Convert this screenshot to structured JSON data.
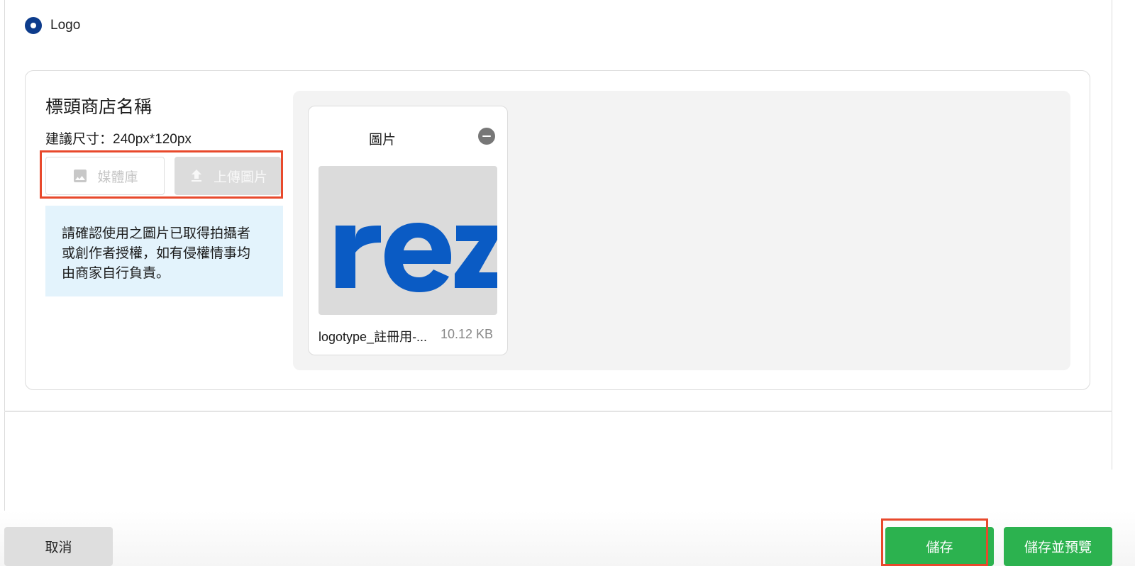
{
  "logo_option": {
    "label": "Logo",
    "selected": true
  },
  "section": {
    "title": "標頭商店名稱",
    "size_hint": "建議尺寸：240px*120px"
  },
  "buttons": {
    "media_library": "媒體庫",
    "upload_image": "上傳圖片"
  },
  "notice": {
    "line1": "請確認使用之圖片已取得拍攝者",
    "line2": "或創作者授權，如有侵權情事均",
    "line3": "由商家自行負責。"
  },
  "image_card": {
    "title": "圖片",
    "file_name": "logotype_註冊用-...",
    "file_size": "10.12 KB",
    "logo_text": "rez"
  },
  "footer": {
    "cancel": "取消",
    "save": "儲存",
    "save_preview": "儲存並預覽"
  },
  "colors": {
    "primary_green": "#2cb24f",
    "highlight_red": "#e8492c",
    "radio_blue": "#0d3c8c",
    "logo_blue": "#0a5bc4"
  },
  "icons": {
    "remove": "minus-circle-icon",
    "media": "image-icon",
    "upload": "upload-icon"
  }
}
